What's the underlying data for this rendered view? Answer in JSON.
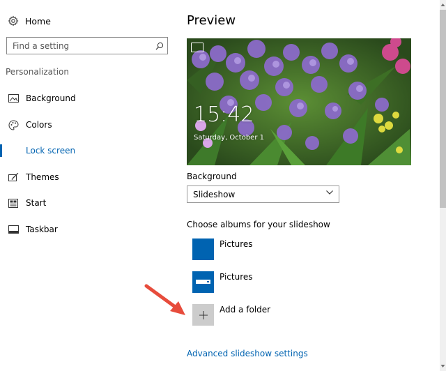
{
  "sidebar": {
    "home_label": "Home",
    "search_placeholder": "Find a setting",
    "section_label": "Personalization",
    "items": [
      {
        "label": "Background",
        "icon": "picture-icon"
      },
      {
        "label": "Colors",
        "icon": "palette-icon"
      },
      {
        "label": "Lock screen",
        "icon": "lock-screen-icon",
        "active": true
      },
      {
        "label": "Themes",
        "icon": "themes-icon"
      },
      {
        "label": "Start",
        "icon": "start-icon"
      },
      {
        "label": "Taskbar",
        "icon": "taskbar-icon"
      }
    ]
  },
  "main": {
    "title": "Preview",
    "preview": {
      "time": "15:42",
      "date": "Saturday, October 1"
    },
    "background_label": "Background",
    "background_value": "Slideshow",
    "albums_label": "Choose albums for your slideshow",
    "albums": [
      {
        "name": "Pictures",
        "icon": "folder-tile"
      },
      {
        "name": "Pictures",
        "icon": "drive-tile"
      }
    ],
    "add_folder_label": "Add a folder",
    "advanced_link": "Advanced slideshow settings"
  },
  "colors": {
    "accent": "#0063b1",
    "tile_blue": "#0063b1",
    "add_tile": "#cccccc",
    "annotation_arrow": "#e74c3c"
  }
}
